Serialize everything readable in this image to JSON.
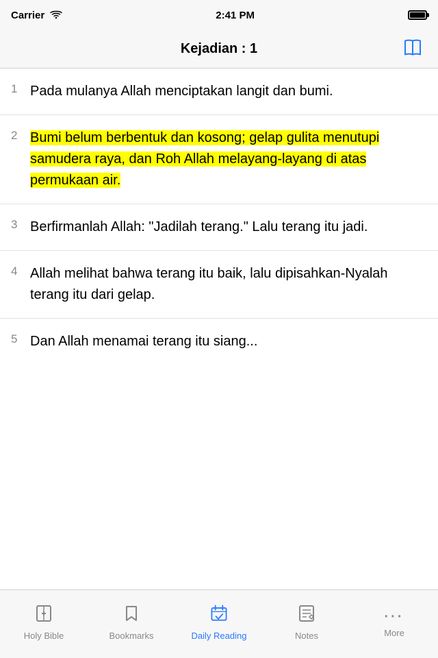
{
  "statusBar": {
    "carrier": "Carrier",
    "time": "2:41 PM"
  },
  "navBar": {
    "title": "Kejadian : 1"
  },
  "verses": [
    {
      "number": "1",
      "text": "Pada mulanya Allah menciptakan langit dan bumi.",
      "highlighted": false
    },
    {
      "number": "2",
      "text": "Bumi belum berbentuk dan kosong; gelap gulita menutupi samudera raya, dan Roh Allah melayang-layang di atas permukaan air.",
      "highlighted": true
    },
    {
      "number": "3",
      "text": "Berfirmanlah Allah: \"Jadilah terang.\" Lalu terang itu jadi.",
      "highlighted": false
    },
    {
      "number": "4",
      "text": "Allah melihat bahwa terang itu baik, lalu dipisahkan-Nyalah terang itu dari gelap.",
      "highlighted": false
    },
    {
      "number": "5",
      "text": "Dan Allah menamai terang itu siang...",
      "highlighted": false,
      "partial": true
    }
  ],
  "tabs": [
    {
      "id": "holy-bible",
      "label": "Holy Bible",
      "active": false
    },
    {
      "id": "bookmarks",
      "label": "Bookmarks",
      "active": false
    },
    {
      "id": "daily-reading",
      "label": "Daily Reading",
      "active": true
    },
    {
      "id": "notes",
      "label": "Notes",
      "active": false
    },
    {
      "id": "more",
      "label": "More",
      "active": false
    }
  ]
}
